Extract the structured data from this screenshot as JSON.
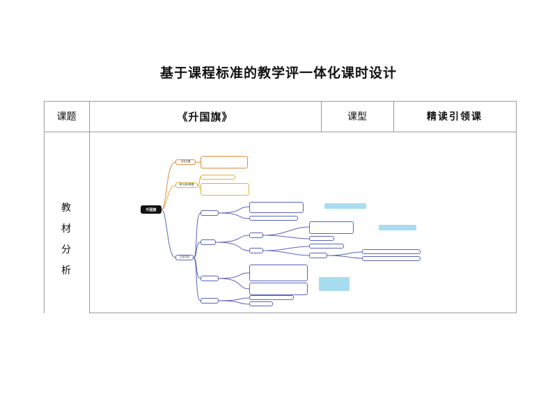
{
  "document": {
    "title": "基于课程标准的教学评一体化课时设计"
  },
  "table": {
    "row1": {
      "topic_label": "课题",
      "topic_value": "《升国旗》",
      "type_label": "课型",
      "type_value": "精读引领课"
    },
    "row2": {
      "label_chars": [
        "教",
        "材",
        "分",
        "析"
      ]
    }
  },
  "mindmap": {
    "root": "升国旗",
    "branches": [
      {
        "label": "文本位置",
        "color": "#e08a3c"
      },
      {
        "label": "单元目标教要",
        "color": "#e0b03c"
      },
      {
        "label": "文本内容",
        "color": "#5a63b8"
      }
    ]
  }
}
